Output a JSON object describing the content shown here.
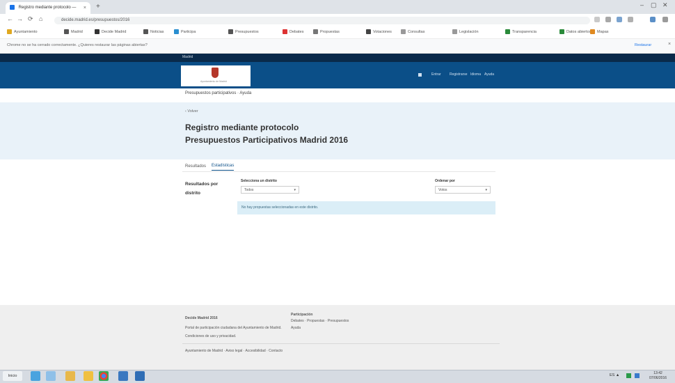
{
  "browser": {
    "tab_title": "Registro mediante protocolo — Presupuesto",
    "tab_close": "×",
    "new_tab": "+",
    "window_controls": [
      "–",
      "▢",
      "✕"
    ],
    "nav_buttons": [
      "←",
      "→",
      "⟳",
      "⌂"
    ],
    "address": "decide.madrid.es/presupuestos/2016",
    "bookmarks": [
      "Ayuntamiento",
      "Madrid",
      "Decide Madrid",
      "Noticias",
      "Participa",
      "Presupuestos",
      "Debates",
      "Propuestas",
      "Votaciones",
      "Consultas",
      "Legislación",
      "Transparencia",
      "Datos abiertos",
      "Mapas"
    ],
    "infobar_text": "Chrome no se ha cerrado correctamente. ¿Quieres restaurar las páginas abiertas?",
    "infobar_link": "Restaurar",
    "infobar_close": "×"
  },
  "site": {
    "topstrip": "Madrid",
    "logo_caption": "Ayuntamiento de Madrid",
    "nav": [
      "Entrar",
      "Registrarse",
      "Idioma",
      "Ayuda"
    ],
    "breadcrumb": "Presupuestos participativos · Ayuda",
    "back_link": "‹ Volver",
    "title_line1": "Registro mediante protocolo",
    "title_line2": "Presupuestos Participativos Madrid 2016",
    "tabs": [
      "Resultados",
      "Estadísticas"
    ],
    "sidebar_heading": "Resultados por distrito",
    "filter1_label": "Selecciona un distrito",
    "filter1_value": "Todos",
    "filter2_label": "Ordenar por",
    "filter2_value": "Votos",
    "notice": "No hay propuestas seleccionadas en este distrito."
  },
  "footer": {
    "col1_title": "Decide Madrid 2016",
    "col1_text1": "Portal de participación ciudadana del Ayuntamiento de Madrid.",
    "col1_text2": "Condiciones de uso y privacidad.",
    "col2_title": "Participación",
    "col2_text1": "Debates · Propuestas · Presupuestos",
    "col2_text2": "Ayuda",
    "bottom": "Ayuntamiento de Madrid · Aviso legal · Accesibilidad · Contacto"
  },
  "taskbar": {
    "start": "Inicio",
    "tray": "ES ▲",
    "time": "13:42",
    "date": "07/06/2016"
  },
  "colors": {
    "header": "#0b4f88",
    "topstrip": "#0a2a4a",
    "hero": "#e9f2f9",
    "notice": "#dbeef7"
  }
}
